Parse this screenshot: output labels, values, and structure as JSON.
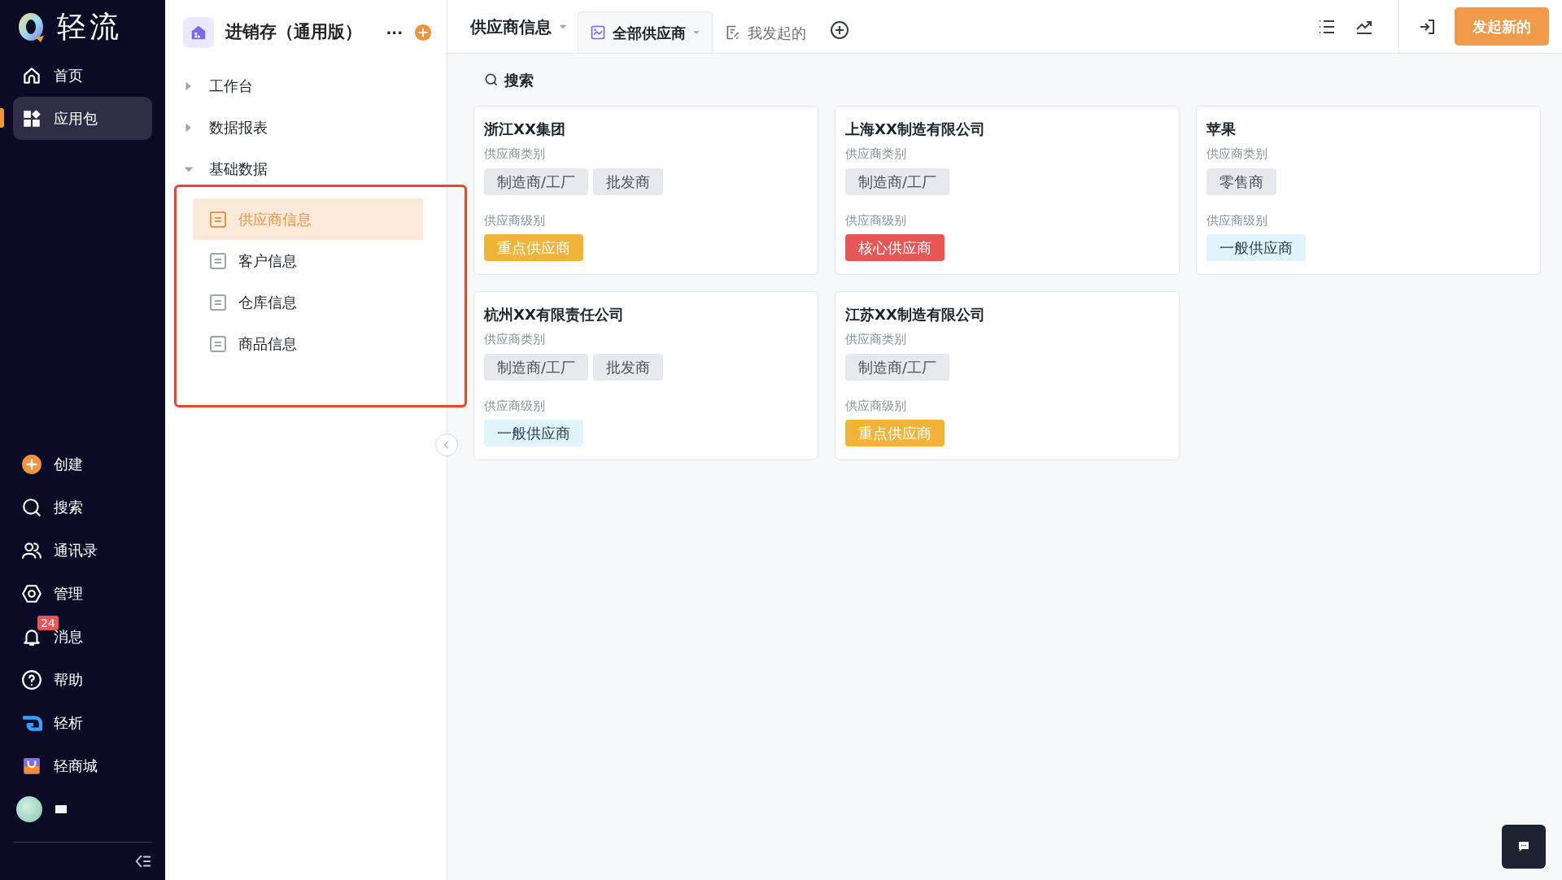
{
  "brand": {
    "name": "轻流"
  },
  "nav_top": [
    {
      "label": "首页",
      "selected": false
    },
    {
      "label": "应用包",
      "selected": true
    }
  ],
  "nav_bottom": [
    {
      "label": "创建"
    },
    {
      "label": "搜索"
    },
    {
      "label": "通讯录"
    },
    {
      "label": "管理"
    },
    {
      "label": "消息",
      "badge": "24"
    },
    {
      "label": "帮助"
    },
    {
      "label": "轻析"
    },
    {
      "label": "轻商城"
    }
  ],
  "app": {
    "title": "进销存（通用版）",
    "more": "···"
  },
  "tree": [
    {
      "label": "工作台",
      "expanded": false
    },
    {
      "label": "数据报表",
      "expanded": false
    },
    {
      "label": "基础数据",
      "expanded": true,
      "children": [
        {
          "label": "供应商信息",
          "selected": true
        },
        {
          "label": "客户信息",
          "selected": false
        },
        {
          "label": "仓库信息",
          "selected": false
        },
        {
          "label": "商品信息",
          "selected": false
        }
      ]
    }
  ],
  "view_title": "供应商信息",
  "tabs": [
    {
      "label": "全部供应商",
      "selected": true
    },
    {
      "label": "我发起的",
      "selected": false
    }
  ],
  "primary_button": "发起新的",
  "search": {
    "label": "搜索"
  },
  "cards": [
    {
      "name": "浙江XX集团",
      "category_label": "供应商类别",
      "categories": [
        "制造商/工厂",
        "批发商"
      ],
      "level_label": "供应商级别",
      "level": {
        "text": "重点供应商",
        "color": "#f0b43a"
      }
    },
    {
      "name": "上海XX制造有限公司",
      "category_label": "供应商类别",
      "categories": [
        "制造商/工厂"
      ],
      "level_label": "供应商级别",
      "level": {
        "text": "核心供应商",
        "color": "#e85656"
      }
    },
    {
      "name": "苹果",
      "category_label": "供应商类别",
      "categories": [
        "零售商"
      ],
      "level_label": "供应商级别",
      "level": {
        "text": "一般供应商",
        "color": "#e1f3fb"
      }
    },
    {
      "name": "杭州XX有限责任公司",
      "category_label": "供应商类别",
      "categories": [
        "制造商/工厂",
        "批发商"
      ],
      "level_label": "供应商级别",
      "level": {
        "text": "一般供应商",
        "color": "#e1f3fb"
      }
    },
    {
      "name": "江苏XX制造有限公司",
      "category_label": "供应商类别",
      "categories": [
        "制造商/工厂"
      ],
      "level_label": "供应商级别",
      "level": {
        "text": "重点供应商",
        "color": "#f0b43a"
      }
    }
  ]
}
